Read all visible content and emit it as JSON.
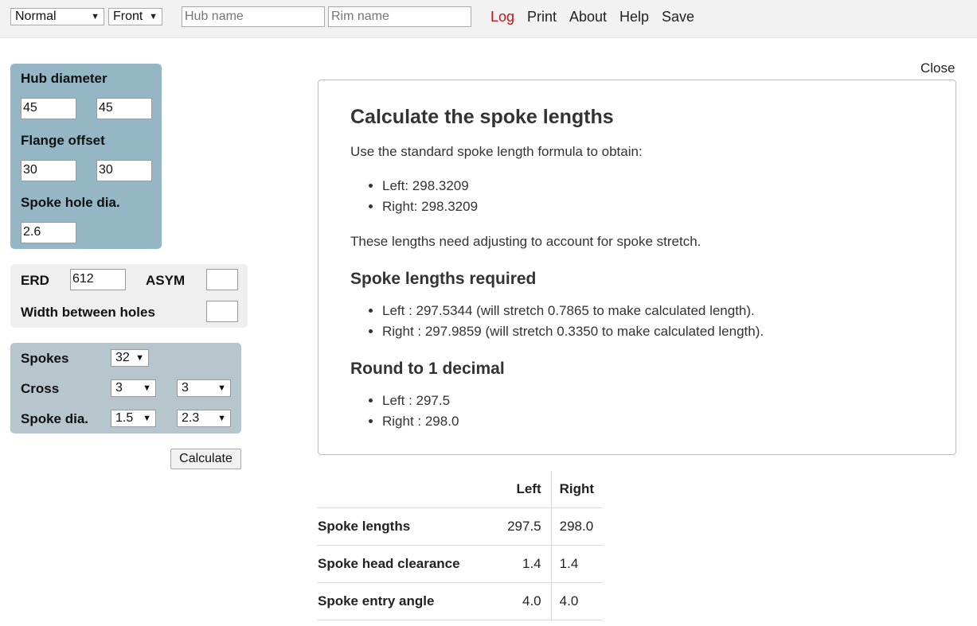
{
  "toolbar": {
    "mode_select": "Normal",
    "wheel_select": "Front",
    "hub_name_placeholder": "Hub name",
    "rim_name_placeholder": "Rim name",
    "links": [
      "Log",
      "Print",
      "About",
      "Help",
      "Save"
    ],
    "active_link": "Log"
  },
  "hub": {
    "diameter_label": "Hub diameter",
    "diameter_left": "45",
    "diameter_right": "45",
    "flange_label": "Flange offset",
    "flange_left": "30",
    "flange_right": "30",
    "hole_label": "Spoke hole dia.",
    "hole_value": "2.6"
  },
  "rim": {
    "erd_label": "ERD",
    "erd_value": "612",
    "asym_label": "ASYM",
    "asym_value": "",
    "width_label": "Width between holes",
    "width_value": ""
  },
  "spokes": {
    "count_label": "Spokes",
    "count_value": "32",
    "cross_label": "Cross",
    "cross_left": "3",
    "cross_right": "3",
    "dia_label": "Spoke dia.",
    "dia_left": "1.5",
    "dia_right": "2.3"
  },
  "calculate_label": "Calculate",
  "close_label": "Close",
  "results": {
    "title": "Calculate the spoke lengths",
    "intro": "Use the standard spoke length formula to obtain:",
    "raw": [
      "Left: 298.3209",
      "Right: 298.3209"
    ],
    "note": "These lengths need adjusting to account for spoke stretch.",
    "required_heading": "Spoke lengths required",
    "required": [
      "Left : 297.5344 (will stretch 0.7865 to make calculated length).",
      "Right : 297.9859 (will stretch 0.3350 to make calculated length)."
    ],
    "round_heading": "Round to 1 decimal",
    "rounded": [
      "Left : 297.5",
      "Right : 298.0"
    ]
  },
  "summary": {
    "headers": [
      "",
      "Left",
      "Right"
    ],
    "rows": [
      [
        "Spoke lengths",
        "297.5",
        "298.0"
      ],
      [
        "Spoke head clearance",
        "1.4",
        "1.4"
      ],
      [
        "Spoke entry angle",
        "4.0",
        "4.0"
      ]
    ]
  }
}
